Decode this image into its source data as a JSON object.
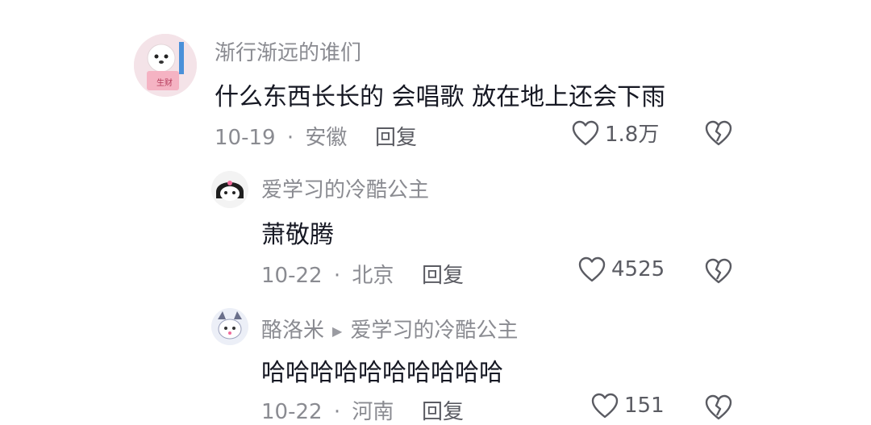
{
  "comments": [
    {
      "username": "渐行渐远的谁们",
      "text": "什么东西长长的 会唱歌 放在地上还会下雨",
      "date": "10-19",
      "separator": "·",
      "location": "安徽",
      "reply_label": "回复",
      "likes": "1.8万",
      "avatar_caption": "生财"
    },
    {
      "username": "爱学习的冷酷公主",
      "text": "萧敬腾",
      "date": "10-22",
      "separator": "·",
      "location": "北京",
      "reply_label": "回复",
      "likes": "4525"
    },
    {
      "username": "酪洛米",
      "reply_to": "爱学习的冷酷公主",
      "text": "哈哈哈哈哈哈哈哈哈哈",
      "date": "10-22",
      "separator": "·",
      "location": "河南",
      "reply_label": "回复",
      "likes": "151"
    }
  ],
  "icons": {
    "like": "heart-outline-icon",
    "dislike": "broken-heart-icon",
    "reply_arrow": "triangle-right-icon"
  },
  "colors": {
    "text": "#161823",
    "secondary": "#8a8b91",
    "action": "#5a5b62"
  }
}
